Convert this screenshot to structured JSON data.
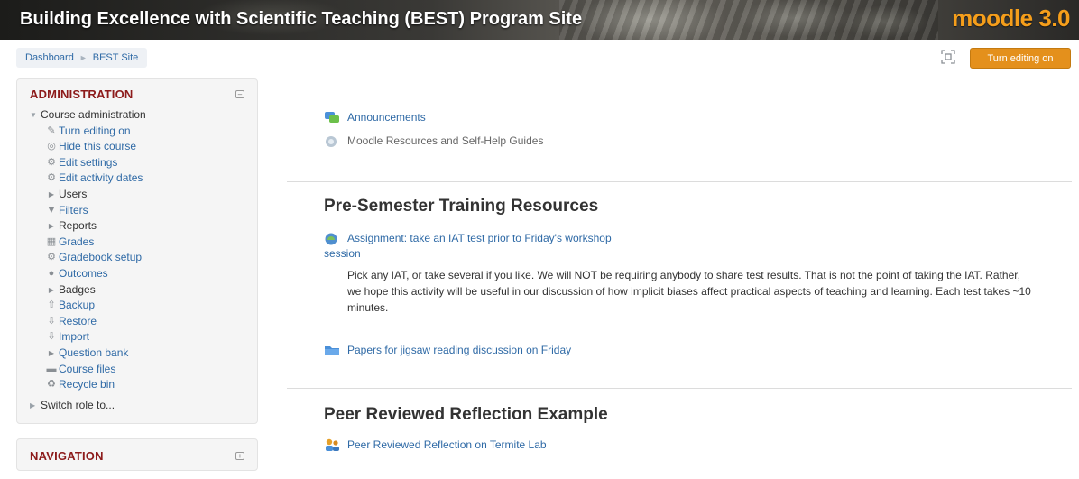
{
  "header": {
    "site_title": "Building Excellence with Scientific Teaching (BEST) Program Site",
    "logo_text": "moodle 3.0"
  },
  "breadcrumb": {
    "items": [
      "Dashboard",
      "BEST Site"
    ]
  },
  "toolbar": {
    "edit_label": "Turn editing on"
  },
  "sidebar": {
    "administration": {
      "title": "ADMINISTRATION",
      "items": [
        {
          "label": "Course administration",
          "icon": "triangle-down-icon",
          "link": false,
          "level": 0
        },
        {
          "label": "Turn editing on",
          "icon": "pencil-icon",
          "link": true,
          "level": 1
        },
        {
          "label": "Hide this course",
          "icon": "eye-icon",
          "link": true,
          "level": 1
        },
        {
          "label": "Edit settings",
          "icon": "gear-icon",
          "link": true,
          "level": 1
        },
        {
          "label": "Edit activity dates",
          "icon": "gear-icon",
          "link": true,
          "level": 1
        },
        {
          "label": "Users",
          "icon": "triangle-right-icon",
          "link": false,
          "level": 1
        },
        {
          "label": "Filters",
          "icon": "filter-icon",
          "link": true,
          "level": 1
        },
        {
          "label": "Reports",
          "icon": "triangle-right-icon",
          "link": false,
          "level": 1
        },
        {
          "label": "Grades",
          "icon": "grades-icon",
          "link": true,
          "level": 1
        },
        {
          "label": "Gradebook setup",
          "icon": "gear-icon",
          "link": true,
          "level": 1
        },
        {
          "label": "Outcomes",
          "icon": "outcomes-icon",
          "link": true,
          "level": 1
        },
        {
          "label": "Badges",
          "icon": "triangle-right-icon",
          "link": false,
          "level": 1
        },
        {
          "label": "Backup",
          "icon": "backup-icon",
          "link": true,
          "level": 1
        },
        {
          "label": "Restore",
          "icon": "restore-icon",
          "link": true,
          "level": 1
        },
        {
          "label": "Import",
          "icon": "import-icon",
          "link": true,
          "level": 1
        },
        {
          "label": "Question bank",
          "icon": "triangle-right-icon",
          "link": true,
          "level": 1
        },
        {
          "label": "Course files",
          "icon": "folder-icon",
          "link": true,
          "level": 1
        },
        {
          "label": "Recycle bin",
          "icon": "recycle-icon",
          "link": true,
          "level": 1
        },
        {
          "label": "Switch role to...",
          "icon": "triangle-right-icon",
          "link": false,
          "level": 0
        }
      ]
    },
    "navigation": {
      "title": "NAVIGATION"
    }
  },
  "main": {
    "top_links": [
      {
        "label": "Announcements",
        "icon": "forum-icon"
      },
      {
        "label": "Moodle Resources and Self-Help Guides",
        "icon": "url-icon"
      }
    ],
    "sections": [
      {
        "heading": "Pre-Semester Training Resources",
        "assignment_line1": "Assignment: take an IAT test prior to Friday's workshop",
        "assignment_line2": "session",
        "description": "Pick any IAT, or take several if you like. We will NOT be requiring anybody to share test results. That is not the point of taking the IAT. Rather, we hope this activity will be useful in our discussion of how implicit biases affect practical aspects of teaching and learning. Each test takes ~10 minutes.",
        "folder_link": "Papers for jigsaw reading discussion on Friday"
      },
      {
        "heading": "Peer Reviewed Reflection Example",
        "workshop_link": "Peer Reviewed Reflection on Termite Lab"
      }
    ]
  },
  "colors": {
    "link": "#2f6aa6",
    "block_title": "#8d1b1b",
    "edit_button": "#e4901c",
    "logo": "#f59e1b"
  }
}
